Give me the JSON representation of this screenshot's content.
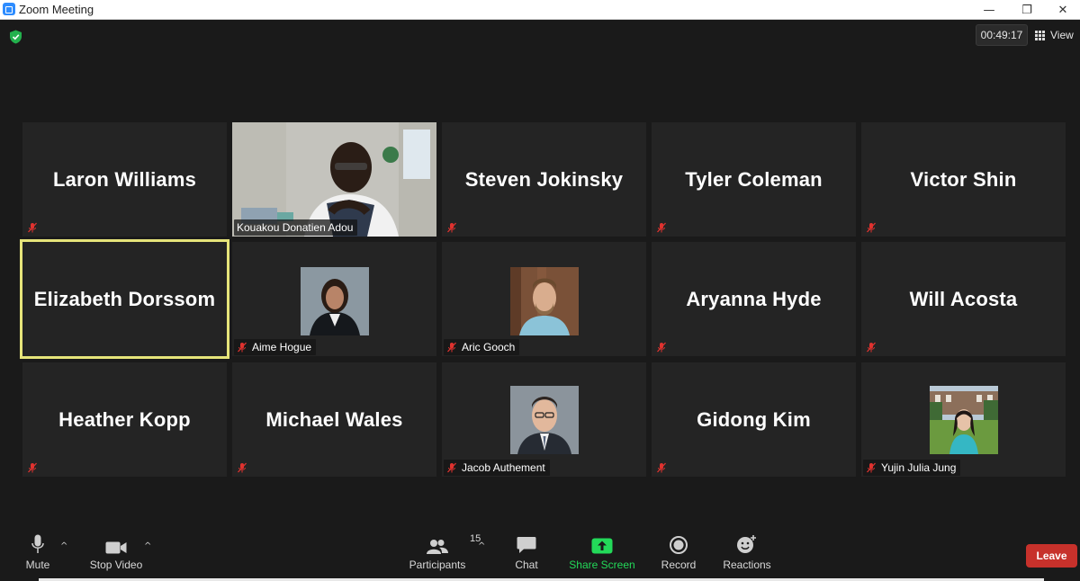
{
  "window": {
    "title": "Zoom Meeting",
    "minimize": "—",
    "restore": "❐",
    "close": "✕"
  },
  "meeting": {
    "timer": "00:49:17",
    "view_label": "View"
  },
  "tiles": [
    {
      "name": "Laron Williams",
      "label": ""
    },
    {
      "name": "",
      "label": "Kouakou Donatien Adou"
    },
    {
      "name": "Steven Jokinsky",
      "label": ""
    },
    {
      "name": "Tyler Coleman",
      "label": ""
    },
    {
      "name": "Victor Shin",
      "label": ""
    },
    {
      "name": "Elizabeth Dorssom",
      "label": ""
    },
    {
      "name": "",
      "label": "Aime Hogue"
    },
    {
      "name": "",
      "label": "Aric Gooch"
    },
    {
      "name": "Aryanna Hyde",
      "label": ""
    },
    {
      "name": "Will Acosta",
      "label": ""
    },
    {
      "name": "Heather Kopp",
      "label": ""
    },
    {
      "name": "Michael Wales",
      "label": ""
    },
    {
      "name": "",
      "label": "Jacob Authement"
    },
    {
      "name": "Gidong Kim",
      "label": ""
    },
    {
      "name": "",
      "label": "Yujin Julia Jung"
    }
  ],
  "toolbar": {
    "mute": "Mute",
    "stop_video": "Stop Video",
    "participants": "Participants",
    "participants_count": "15",
    "chat": "Chat",
    "share_screen": "Share Screen",
    "record": "Record",
    "reactions": "Reactions",
    "leave": "Leave",
    "caret": "^"
  },
  "colors": {
    "accent_green": "#23d959",
    "leave_red": "#c7312b",
    "active_speaker": "#e6e47a",
    "muted_red": "#e0322f"
  }
}
